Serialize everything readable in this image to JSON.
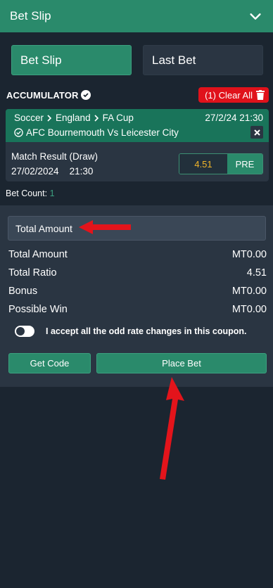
{
  "header": {
    "title": "Bet Slip"
  },
  "tabs": [
    {
      "label": "Bet Slip",
      "active": true
    },
    {
      "label": "Last Bet",
      "active": false
    }
  ],
  "accumulator": {
    "label": "ACCUMULATOR",
    "clear_label": "(1) Clear All"
  },
  "bet": {
    "path": [
      "Soccer",
      "England",
      "FA Cup"
    ],
    "date_short": "27/2/24 21:30",
    "match": "AFC Bournemouth Vs Leicester City",
    "market": "Match Result (Draw)",
    "date": "27/02/2024",
    "time": "21:30",
    "odds": "4.51",
    "tag": "PRE"
  },
  "count": {
    "label": "Bet Count:",
    "value": "1"
  },
  "stake": {
    "placeholder": "Total Amount"
  },
  "summary": [
    {
      "label": "Total Amount",
      "value": "MT0.00"
    },
    {
      "label": "Total Ratio",
      "value": "4.51"
    },
    {
      "label": "Bonus",
      "value": "MT0.00"
    },
    {
      "label": "Possible Win",
      "value": "MT0.00"
    }
  ],
  "accept": {
    "label": "I accept all the odd rate changes in this coupon.",
    "checked": false
  },
  "buttons": {
    "get_code": "Get Code",
    "place_bet": "Place Bet"
  },
  "colors": {
    "primary": "#2a8a6b",
    "background": "#1b2530",
    "panel": "#2a3542",
    "clear": "#e0121b",
    "odds": "#f0b429",
    "arrow": "#e3141b"
  }
}
